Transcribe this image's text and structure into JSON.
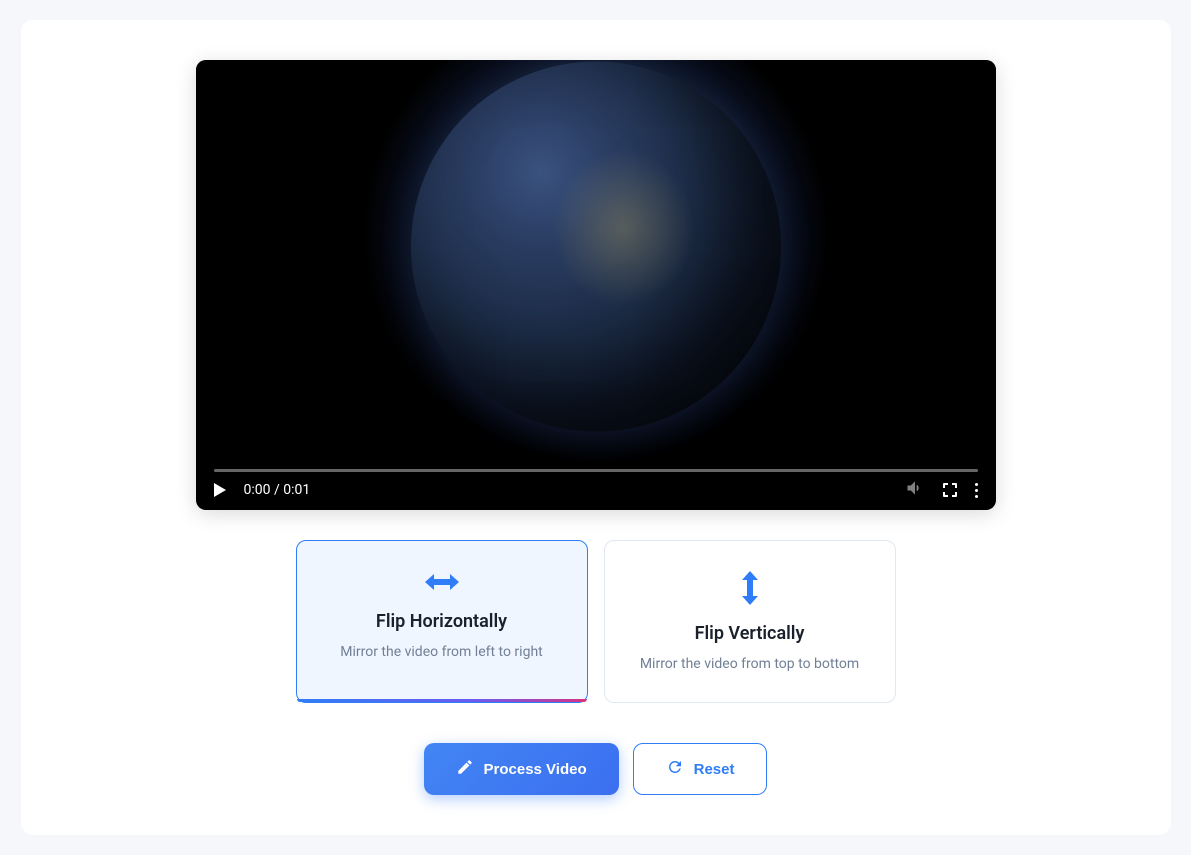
{
  "video": {
    "current_time": "0:00",
    "duration": "0:01",
    "time_display": "0:00 / 0:01"
  },
  "options": {
    "horizontal": {
      "title": "Flip Horizontally",
      "description": "Mirror the video from left to right",
      "selected": true
    },
    "vertical": {
      "title": "Flip Vertically",
      "description": "Mirror the video from top to bottom",
      "selected": false
    }
  },
  "buttons": {
    "process": "Process Video",
    "reset": "Reset"
  }
}
